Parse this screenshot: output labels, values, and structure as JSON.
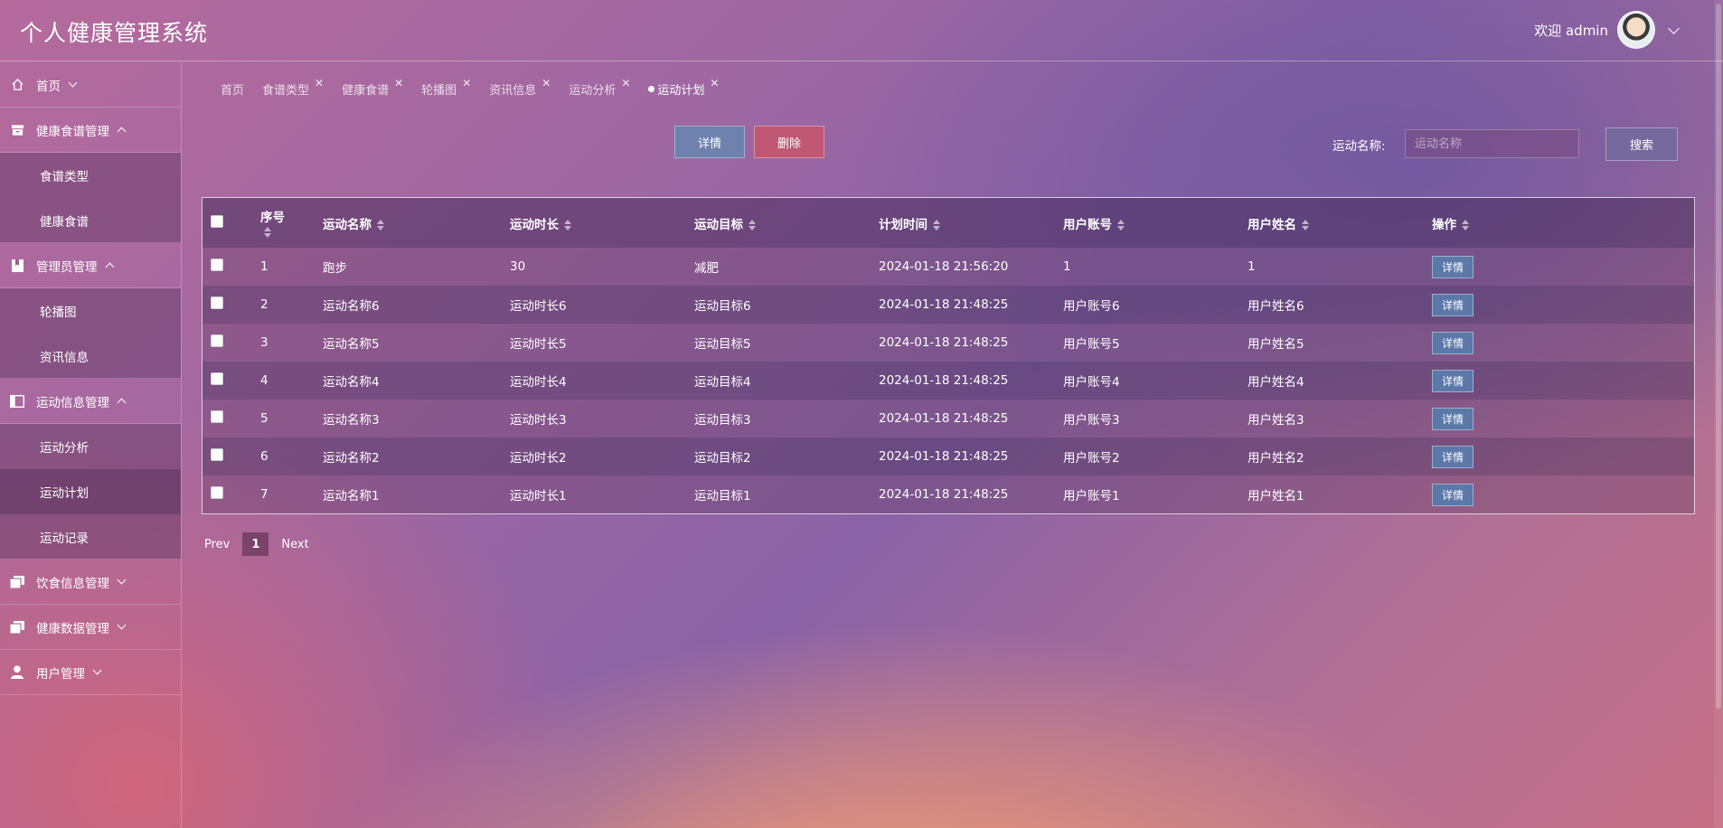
{
  "header": {
    "title": "个人健康管理系统",
    "welcome": "欢迎 admin"
  },
  "sidebar": {
    "menus": [
      {
        "label": "首页",
        "icon": "home-icon"
      },
      {
        "label": "健康食谱管理",
        "icon": "archive-icon",
        "children": [
          "食谱类型",
          "健康食谱"
        ]
      },
      {
        "label": "管理员管理",
        "icon": "bookmark-icon",
        "children": [
          "轮播图",
          "资讯信息"
        ]
      },
      {
        "label": "运动信息管理",
        "icon": "panel-icon",
        "children": [
          "运动分析",
          "运动计划",
          "运动记录"
        ]
      },
      {
        "label": "饮食信息管理",
        "icon": "stack-icon"
      },
      {
        "label": "健康数据管理",
        "icon": "stack-icon"
      },
      {
        "label": "用户管理",
        "icon": "user-icon"
      }
    ]
  },
  "tabs": [
    "首页",
    "食谱类型",
    "健康食谱",
    "轮播图",
    "资讯信息",
    "运动分析",
    "运动计划"
  ],
  "toolbar": {
    "detail_label": "详情",
    "delete_label": "删除",
    "search_label": "运动名称:",
    "search_placeholder": "运动名称",
    "search_button": "搜索"
  },
  "table": {
    "columns": [
      "序号",
      "运动名称",
      "运动时长",
      "运动目标",
      "计划时间",
      "用户账号",
      "用户姓名",
      "操作"
    ],
    "row_action": "详情",
    "rows": [
      [
        "1",
        "跑步",
        "30",
        "减肥",
        "2024-01-18 21:56:20",
        "1",
        "1"
      ],
      [
        "2",
        "运动名称6",
        "运动时长6",
        "运动目标6",
        "2024-01-18 21:48:25",
        "用户账号6",
        "用户姓名6"
      ],
      [
        "3",
        "运动名称5",
        "运动时长5",
        "运动目标5",
        "2024-01-18 21:48:25",
        "用户账号5",
        "用户姓名5"
      ],
      [
        "4",
        "运动名称4",
        "运动时长4",
        "运动目标4",
        "2024-01-18 21:48:25",
        "用户账号4",
        "用户姓名4"
      ],
      [
        "5",
        "运动名称3",
        "运动时长3",
        "运动目标3",
        "2024-01-18 21:48:25",
        "用户账号3",
        "用户姓名3"
      ],
      [
        "6",
        "运动名称2",
        "运动时长2",
        "运动目标2",
        "2024-01-18 21:48:25",
        "用户账号2",
        "用户姓名2"
      ],
      [
        "7",
        "运动名称1",
        "运动时长1",
        "运动目标1",
        "2024-01-18 21:48:25",
        "用户账号1",
        "用户姓名1"
      ]
    ]
  },
  "pager": {
    "prev": "Prev",
    "page": "1",
    "next": "Next"
  }
}
